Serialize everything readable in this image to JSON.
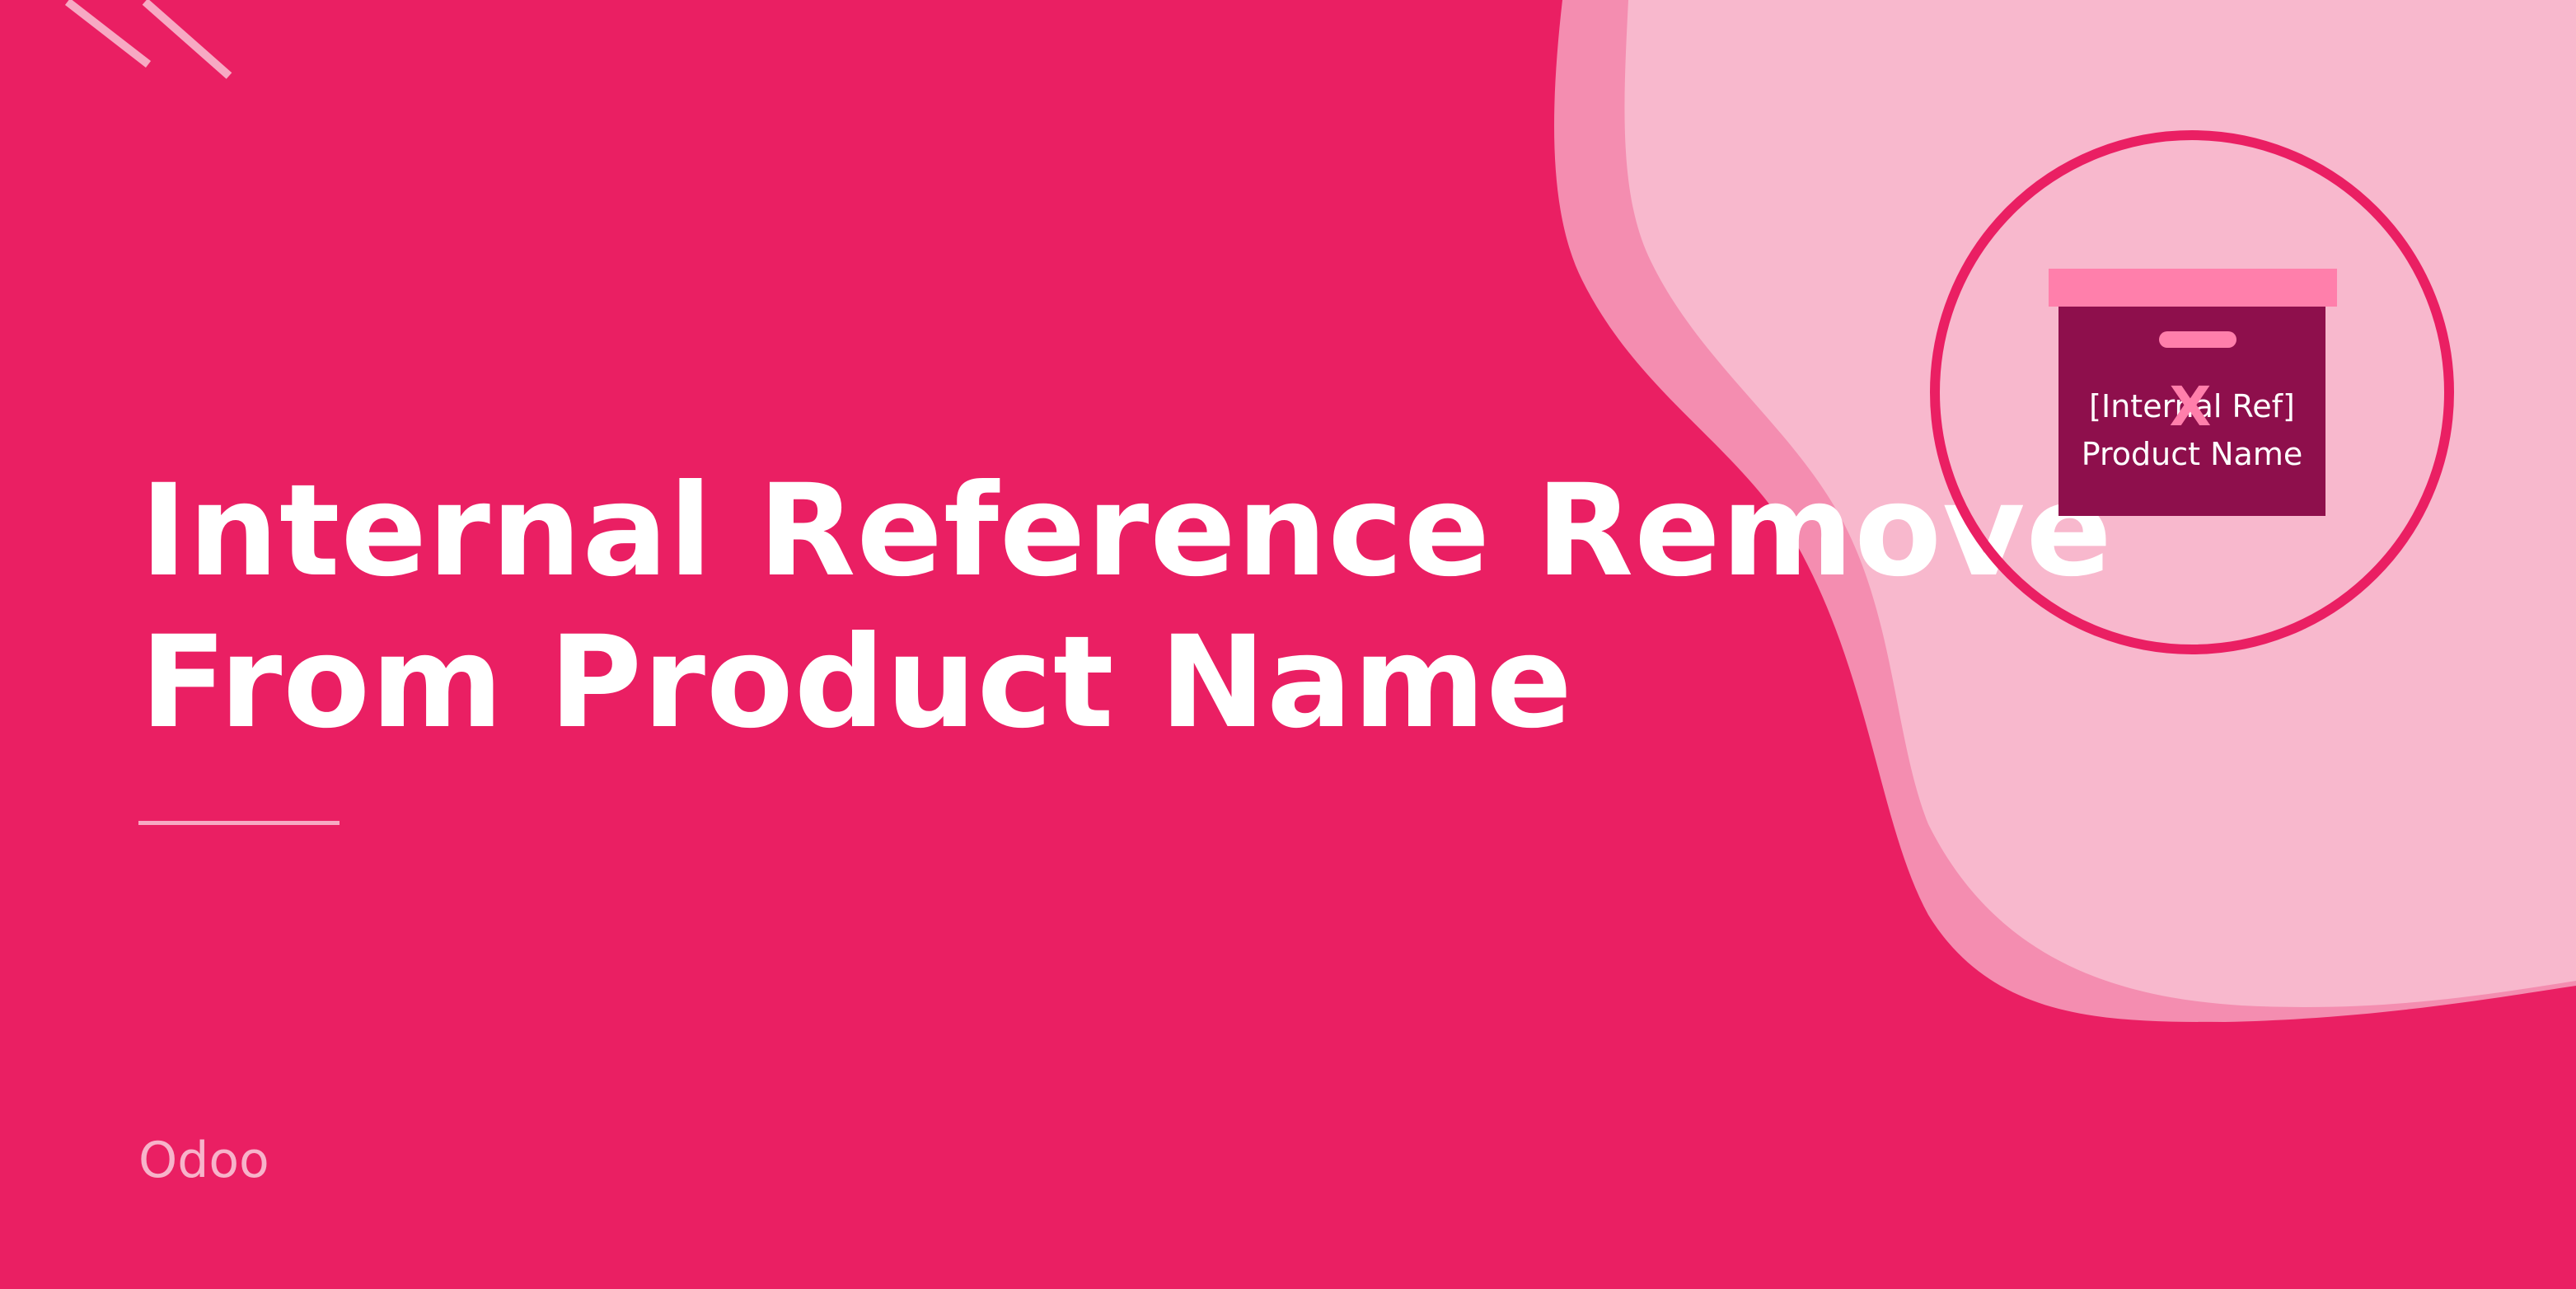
{
  "banner": {
    "title_line_1": "Internal Reference Remove",
    "title_line_2": "From Product Name",
    "brand": "Odoo"
  },
  "icon": {
    "tag_line_1": "[Internal Ref]",
    "tag_line_2": "Product Name",
    "remove_mark": "X"
  },
  "colors": {
    "background": "#ea1f63",
    "wave_mid": "#f48db0",
    "wave_light": "#f8b8cd",
    "box_body": "#8e0f4c",
    "box_lid": "#ff7fab",
    "circle_outline": "#ea1f63"
  }
}
